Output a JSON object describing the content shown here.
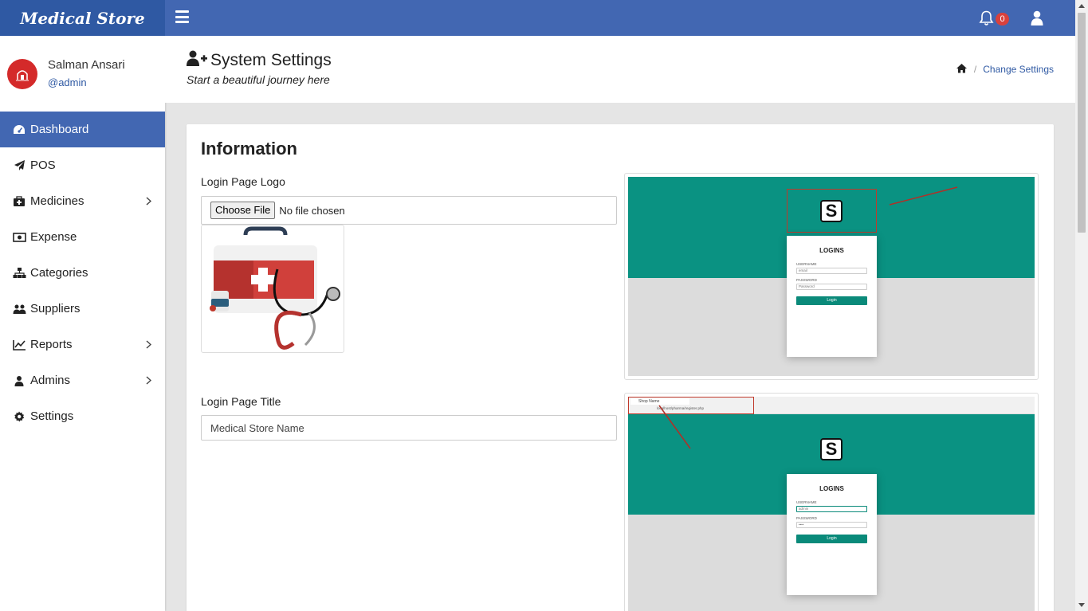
{
  "brand": {
    "name": "Medical Store"
  },
  "user": {
    "name": "Salman Ansari",
    "role": "@admin"
  },
  "sidebar": {
    "items": [
      {
        "label": "Dashboard",
        "icon": "dashboard-icon",
        "active": true
      },
      {
        "label": "POS",
        "icon": "paper-plane-icon"
      },
      {
        "label": "Medicines",
        "icon": "medkit-icon",
        "has_submenu": true
      },
      {
        "label": "Expense",
        "icon": "money-icon"
      },
      {
        "label": "Categories",
        "icon": "sitemap-icon"
      },
      {
        "label": "Suppliers",
        "icon": "users-icon"
      },
      {
        "label": "Reports",
        "icon": "line-chart-icon",
        "has_submenu": true
      },
      {
        "label": "Admins",
        "icon": "user-icon",
        "has_submenu": true
      },
      {
        "label": "Settings",
        "icon": "gear-icon"
      }
    ]
  },
  "topbar": {
    "notification_count": "0"
  },
  "header": {
    "title": "System Settings",
    "subtitle": "Start a beautiful journey here",
    "breadcrumb": {
      "current": "Change Settings"
    }
  },
  "card": {
    "title": "Information",
    "logo_field": {
      "label": "Login Page Logo",
      "button": "Choose File",
      "status": "No file chosen"
    },
    "title_field": {
      "label": "Login Page Title",
      "value": "Medical Store Name"
    }
  },
  "preview": {
    "logo_letter": "S",
    "login_heading": "LOGINS",
    "username_label": "USERNAME",
    "password_label": "PASSWORD",
    "shot1": {
      "username": "email",
      "password": "Password"
    },
    "shot2": {
      "username": "admin",
      "password": "••••"
    },
    "login_button": "Login",
    "tab_title": "Shop Name",
    "url": "localhost/pharma/register.php"
  },
  "colors": {
    "primary": "#4267b2",
    "brand": "#2f59a3",
    "teal": "#0a9282",
    "badge": "#d9413d"
  }
}
